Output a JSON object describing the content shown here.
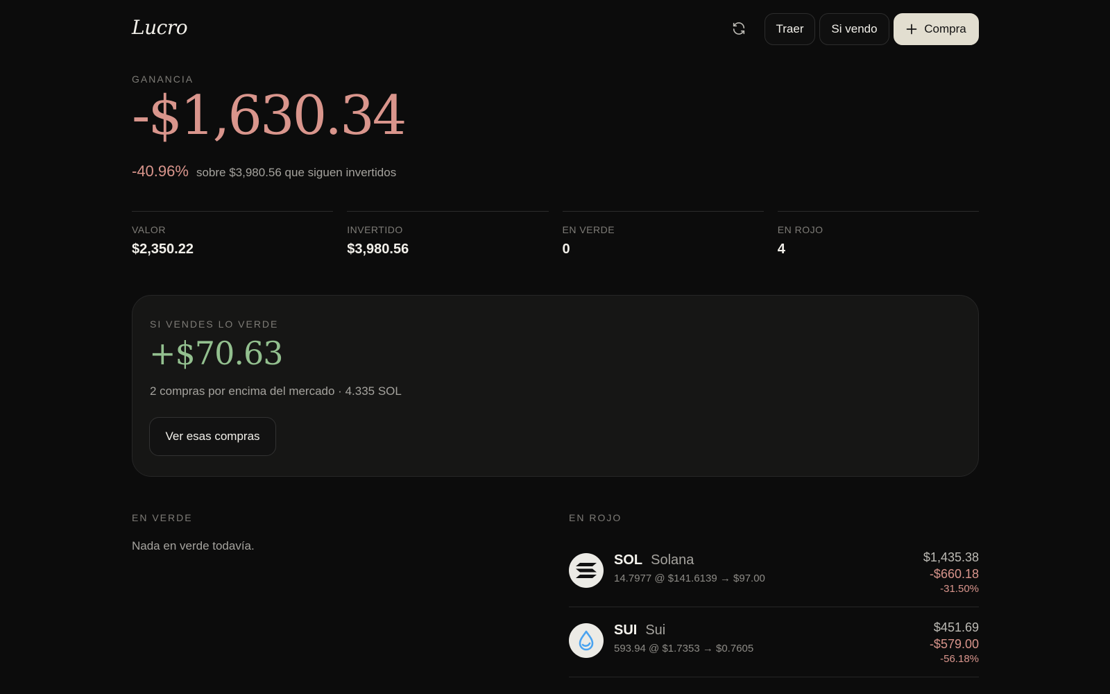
{
  "app": {
    "logo": "Lucro"
  },
  "header": {
    "refresh_icon": "refresh-icon",
    "traer_label": "Traer",
    "si_vendo_label": "Si vendo",
    "compra_label": "Compra",
    "compra_icon": "plus-icon"
  },
  "hero": {
    "label": "GANANCIA",
    "value": "-$1,630.34",
    "percent": "-40.96%",
    "note": "sobre $3,980.56 que siguen invertidos",
    "color": "#d9958c"
  },
  "stats": [
    {
      "label": "VALOR",
      "value": "$2,350.22"
    },
    {
      "label": "INVERTIDO",
      "value": "$3,980.56"
    },
    {
      "label": "EN VERDE",
      "value": "0"
    },
    {
      "label": "EN ROJO",
      "value": "4"
    }
  ],
  "sell_card": {
    "label": "SI VENDES LO VERDE",
    "value": "+$70.63",
    "note": "2 compras por encima del mercado · 4.335 SOL",
    "button_label": "Ver esas compras",
    "color": "#93c08f"
  },
  "green_section": {
    "label": "EN VERDE",
    "empty_text": "Nada en verde todavía."
  },
  "red_section": {
    "label": "EN ROJO",
    "assets": [
      {
        "symbol": "SOL",
        "name": "Solana",
        "icon": "solana-icon",
        "detail": "14.7977 @ $141.6139 → $97.00",
        "value": "$1,435.38",
        "loss": "-$660.18",
        "percent": "-31.50%"
      },
      {
        "symbol": "SUI",
        "name": "Sui",
        "icon": "sui-drop-icon",
        "detail": "593.94 @ $1.7353 → $0.7605",
        "value": "$451.69",
        "loss": "-$579.00",
        "percent": "-56.18%"
      }
    ]
  }
}
